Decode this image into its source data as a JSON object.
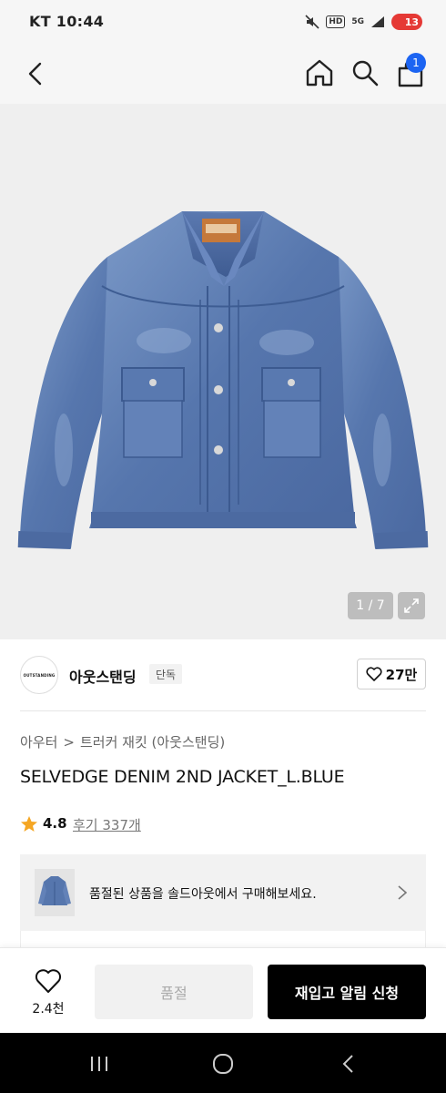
{
  "status_bar": {
    "carrier_time": "KT 10:44",
    "hd_label": "HD",
    "network_label": "5G",
    "battery_label": "13",
    "icons": [
      "mute-icon",
      "hd-icon",
      "signal-icon",
      "wifi-icon",
      "battery-icon"
    ]
  },
  "nav": {
    "icons": [
      "back-icon",
      "home-icon",
      "search-icon",
      "cart-icon"
    ],
    "cart_badge": "1"
  },
  "gallery": {
    "counter": "1 / 7",
    "expand_icon": "expand-icon"
  },
  "brand": {
    "logo_text": "OUTSTANDING",
    "name": "아웃스탠딩",
    "tag": "단독",
    "likes": "27만"
  },
  "breadcrumb": {
    "category": "아우터",
    "separator": ">",
    "subcategory": "트러커 재킷 (아웃스탠딩)"
  },
  "product": {
    "title": "SELVEDGE DENIM 2ND JACKET_L.BLUE",
    "rating": "4.8",
    "reviews": "후기 337개"
  },
  "soldout_banner": {
    "text": "품절된 상품을 솔드아웃에서 구매해보세요."
  },
  "bottom_bar": {
    "likes": "2.4천",
    "soldout_label": "품절",
    "restock_label": "재입고 알림 신청"
  },
  "colors": {
    "cart_badge": "#1c64f2",
    "star": "#f5a623",
    "battery": "#e53935",
    "restock_button": "#000000"
  }
}
